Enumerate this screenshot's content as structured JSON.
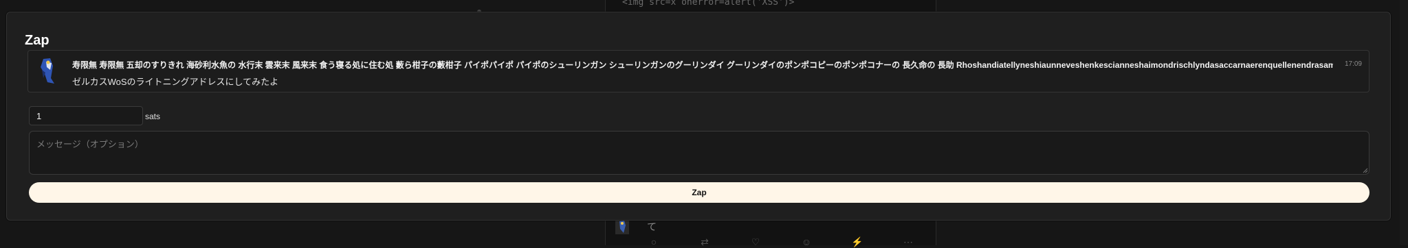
{
  "background": {
    "snippet": "<img src=x onerror=alert('XSS')>",
    "feed_text": "て",
    "actions": [
      "reply-icon",
      "repost-icon",
      "like-icon",
      "emoji-icon",
      "zap-icon",
      "more-icon"
    ]
  },
  "modal": {
    "title": "Zap",
    "note": {
      "author": "寿限無 寿限無 五却のすりきれ 海砂利水魚の 水行末 雲来末 風来末 食う寝る処に住む処 藪ら柑子の藪柑子 パイポパイポ パイポのシューリンガン シューリンガンのグーリンダイ グーリンダイのポンポコピーのポンポコナーの 長久命の 長助 Rhoshandiatellyneshiaunneveshenkescianneshaimondrischlyndasaccarnaerenquellenendrasamecashaunequa",
      "time": "17:09",
      "body": "ゼルカスWoSのライトニングアドレスにしてみたよ"
    },
    "amount": {
      "value": "1",
      "unit": "sats"
    },
    "message": {
      "placeholder": "メッセージ（オプション）",
      "value": ""
    },
    "submit_label": "Zap"
  },
  "colors": {
    "modal_bg": "#1f1f1f",
    "button_bg": "#fff6e8",
    "page_bg": "#161616"
  }
}
